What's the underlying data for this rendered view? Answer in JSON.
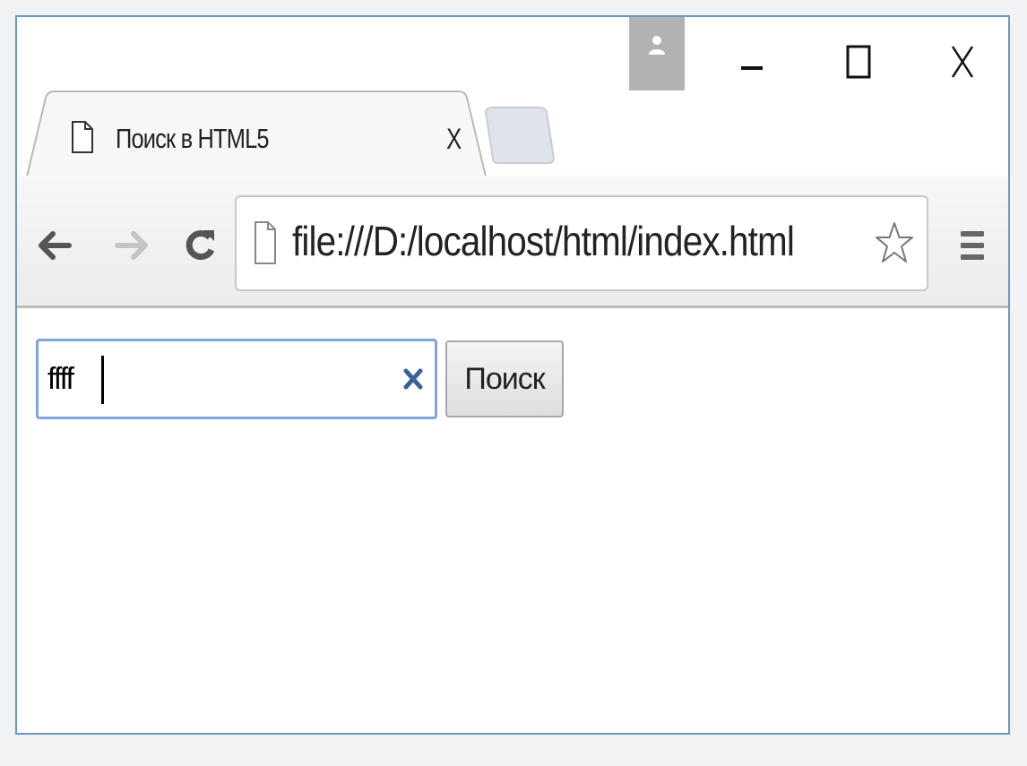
{
  "browser": {
    "tab": {
      "title": "Поиск в HTML5",
      "close_label": "X"
    },
    "window_controls": {
      "minimize_icon": "minimize-icon",
      "maximize_icon": "maximize-icon",
      "close_icon": "close-icon"
    },
    "address_bar": {
      "url": "file:///D:/localhost/html/index.html"
    }
  },
  "page": {
    "search": {
      "value": "ffff",
      "button_label": "Поиск"
    }
  },
  "colors": {
    "window_border": "#6a97c4",
    "input_focus_border": "#7fa5d9",
    "clear_icon": "#3a5f9a",
    "avatar_bg": "#b2b2b2"
  }
}
